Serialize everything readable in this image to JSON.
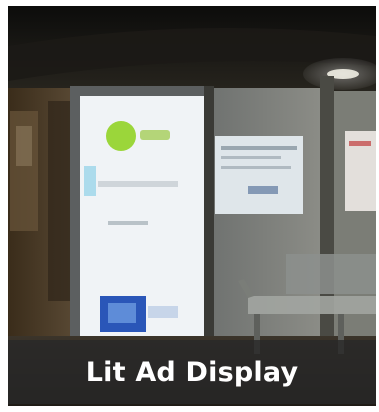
{
  "caption": "Lit Ad Display",
  "colors": {
    "caption_bg": "#282828",
    "caption_text": "#ffffff",
    "ad_panel": "#e9edf1",
    "logo_green": "#9bd63a"
  }
}
